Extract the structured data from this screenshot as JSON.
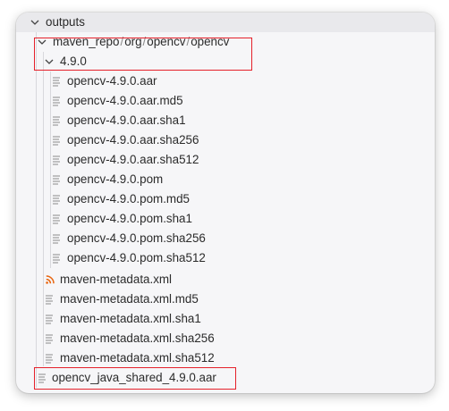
{
  "colors": {
    "highlight": "#e5202a",
    "rss_icon": "#e8650f",
    "panel_bg": "#f6f6f8"
  },
  "tree": {
    "root": {
      "label": "outputs",
      "icon": "chevron-down-icon"
    },
    "maven_repo_path": {
      "segments": [
        "maven_repo",
        "org",
        "opencv",
        "opencv"
      ],
      "separator": "/",
      "icon": "chevron-down-icon"
    },
    "version_folder": {
      "label": "4.9.0",
      "icon": "chevron-down-icon"
    },
    "version_files": [
      {
        "label": "opencv-4.9.0.aar",
        "icon": "file-lines-icon"
      },
      {
        "label": "opencv-4.9.0.aar.md5",
        "icon": "file-lines-icon"
      },
      {
        "label": "opencv-4.9.0.aar.sha1",
        "icon": "file-lines-icon"
      },
      {
        "label": "opencv-4.9.0.aar.sha256",
        "icon": "file-lines-icon"
      },
      {
        "label": "opencv-4.9.0.aar.sha512",
        "icon": "file-lines-icon"
      },
      {
        "label": "opencv-4.9.0.pom",
        "icon": "file-lines-icon"
      },
      {
        "label": "opencv-4.9.0.pom.md5",
        "icon": "file-lines-icon"
      },
      {
        "label": "opencv-4.9.0.pom.sha1",
        "icon": "file-lines-icon"
      },
      {
        "label": "opencv-4.9.0.pom.sha256",
        "icon": "file-lines-icon"
      },
      {
        "label": "opencv-4.9.0.pom.sha512",
        "icon": "file-lines-icon"
      }
    ],
    "metadata_files": [
      {
        "label": "maven-metadata.xml",
        "icon": "rss-icon"
      },
      {
        "label": "maven-metadata.xml.md5",
        "icon": "file-lines-icon"
      },
      {
        "label": "maven-metadata.xml.sha1",
        "icon": "file-lines-icon"
      },
      {
        "label": "maven-metadata.xml.sha256",
        "icon": "file-lines-icon"
      },
      {
        "label": "maven-metadata.xml.sha512",
        "icon": "file-lines-icon"
      }
    ],
    "shared_aar": {
      "label": "opencv_java_shared_4.9.0.aar",
      "icon": "file-lines-icon"
    }
  }
}
